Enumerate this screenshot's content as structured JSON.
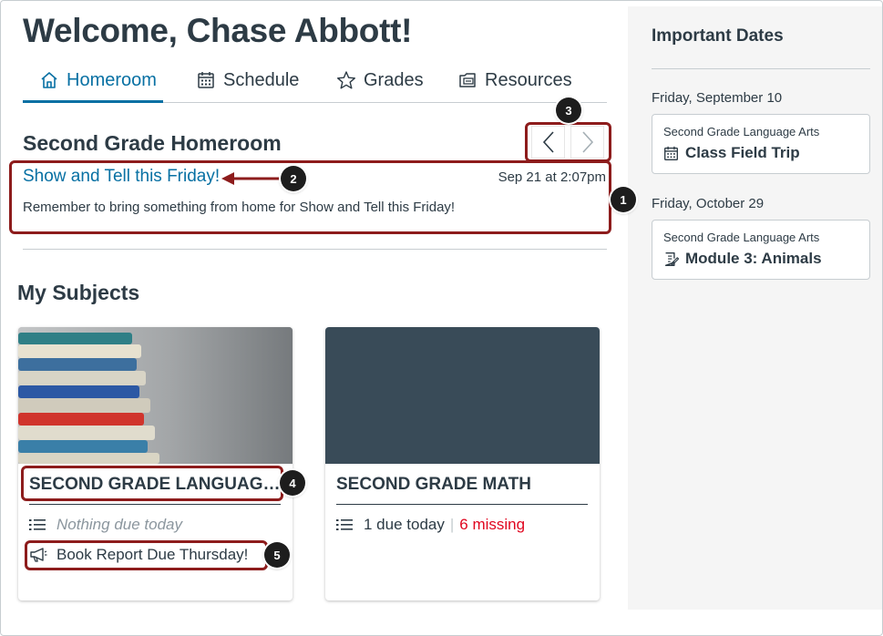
{
  "welcome": "Welcome, Chase Abbott!",
  "tabs": [
    {
      "label": "Homeroom",
      "icon": "home-icon",
      "active": true
    },
    {
      "label": "Schedule",
      "icon": "calendar-icon",
      "active": false
    },
    {
      "label": "Grades",
      "icon": "star-icon",
      "active": false
    },
    {
      "label": "Resources",
      "icon": "resources-icon",
      "active": false
    }
  ],
  "homeroom": {
    "title": "Second Grade Homeroom",
    "announcement": {
      "title": "Show and Tell this Friday!",
      "date": "Sep 21 at 2:07pm",
      "body": "Remember to bring something from home for Show and Tell this Friday!"
    }
  },
  "subjects": {
    "heading": "My Subjects",
    "cards": [
      {
        "title": "SECOND GRADE LANGUAGE ARTS",
        "status": "Nothing due today",
        "announcement": "Book Report Due Thursday!"
      },
      {
        "title": "SECOND GRADE MATH",
        "due": "1 due today",
        "separator": "|",
        "missing": "6 missing"
      }
    ]
  },
  "sidebar": {
    "title": "Important Dates",
    "groups": [
      {
        "date": "Friday, September 10",
        "course": "Second Grade Language Arts",
        "item": "Class Field Trip",
        "icon": "calendar-icon"
      },
      {
        "date": "Friday, October 29",
        "course": "Second Grade Language Arts",
        "item": "Module 3: Animals",
        "icon": "assignment-icon"
      }
    ]
  },
  "callouts": [
    "1",
    "2",
    "3",
    "4",
    "5"
  ],
  "colors": {
    "accent": "#0770a3",
    "text": "#2d3b45",
    "missing": "#e0061f",
    "callout_border": "#8d1c1c",
    "math_card": "#394b58"
  }
}
